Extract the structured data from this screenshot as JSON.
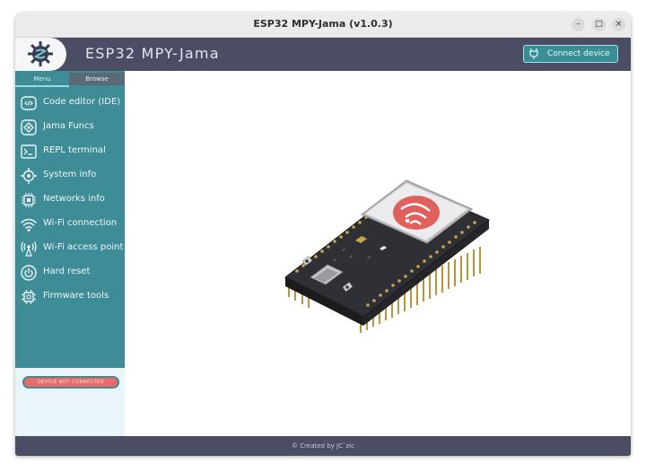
{
  "window": {
    "title": "ESP32 MPY-Jama (v1.0.3)",
    "controls": {
      "minimize": "–",
      "maximize": "□",
      "close": "×"
    }
  },
  "header": {
    "app_title": "ESP32 MPY-Jama",
    "connect_label": "Connect device"
  },
  "sidebar": {
    "tabs": {
      "menu": "Menu",
      "browse": "Browse"
    },
    "items": [
      {
        "label": "Code editor (IDE)",
        "icon": "code-icon"
      },
      {
        "label": "Jama Funcs",
        "icon": "funcs-icon"
      },
      {
        "label": "REPL terminal",
        "icon": "terminal-icon"
      },
      {
        "label": "System info",
        "icon": "system-info-icon"
      },
      {
        "label": "Networks info",
        "icon": "networks-icon"
      },
      {
        "label": "Wi-Fi connection",
        "icon": "wifi-icon"
      },
      {
        "label": "Wi-Fi access point",
        "icon": "access-point-icon"
      },
      {
        "label": "Hard reset",
        "icon": "power-icon"
      },
      {
        "label": "Firmware tools",
        "icon": "chip-icon"
      }
    ],
    "status": "DEVICE NOT CONNECTED"
  },
  "footer": {
    "credit": "© Created by JC`zic"
  },
  "colors": {
    "teal": "#3e8c96",
    "header": "#4a4d63",
    "status_red": "#e86a6a",
    "board": "#2e2e32",
    "espressif_red": "#e0605e"
  }
}
